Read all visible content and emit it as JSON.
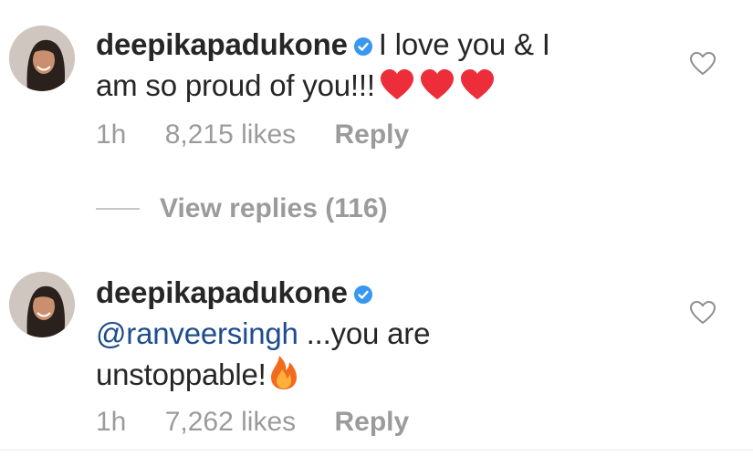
{
  "comments": [
    {
      "username": "deepikapadukone",
      "text_parts": [
        "I love you & I",
        "am so proud of you!!!"
      ],
      "emojis": [
        "heart-icon",
        "heart-icon",
        "heart-icon"
      ],
      "time": "1h",
      "likes": "8,215 likes",
      "reply": "Reply"
    },
    {
      "username": "deepikapadukone",
      "mention": "@ranveersingh",
      "text_parts": [
        "...you are",
        "unstoppable!"
      ],
      "emojis": [
        "fire-icon"
      ],
      "time": "1h",
      "likes": "7,262 likes",
      "reply": "Reply"
    }
  ],
  "view_replies": "View replies (116)",
  "colors": {
    "text": "#262626",
    "muted": "#9b9b9b",
    "verified": "#3897f0",
    "mention": "#1f4c8f",
    "heart": "#ed2d3a"
  }
}
